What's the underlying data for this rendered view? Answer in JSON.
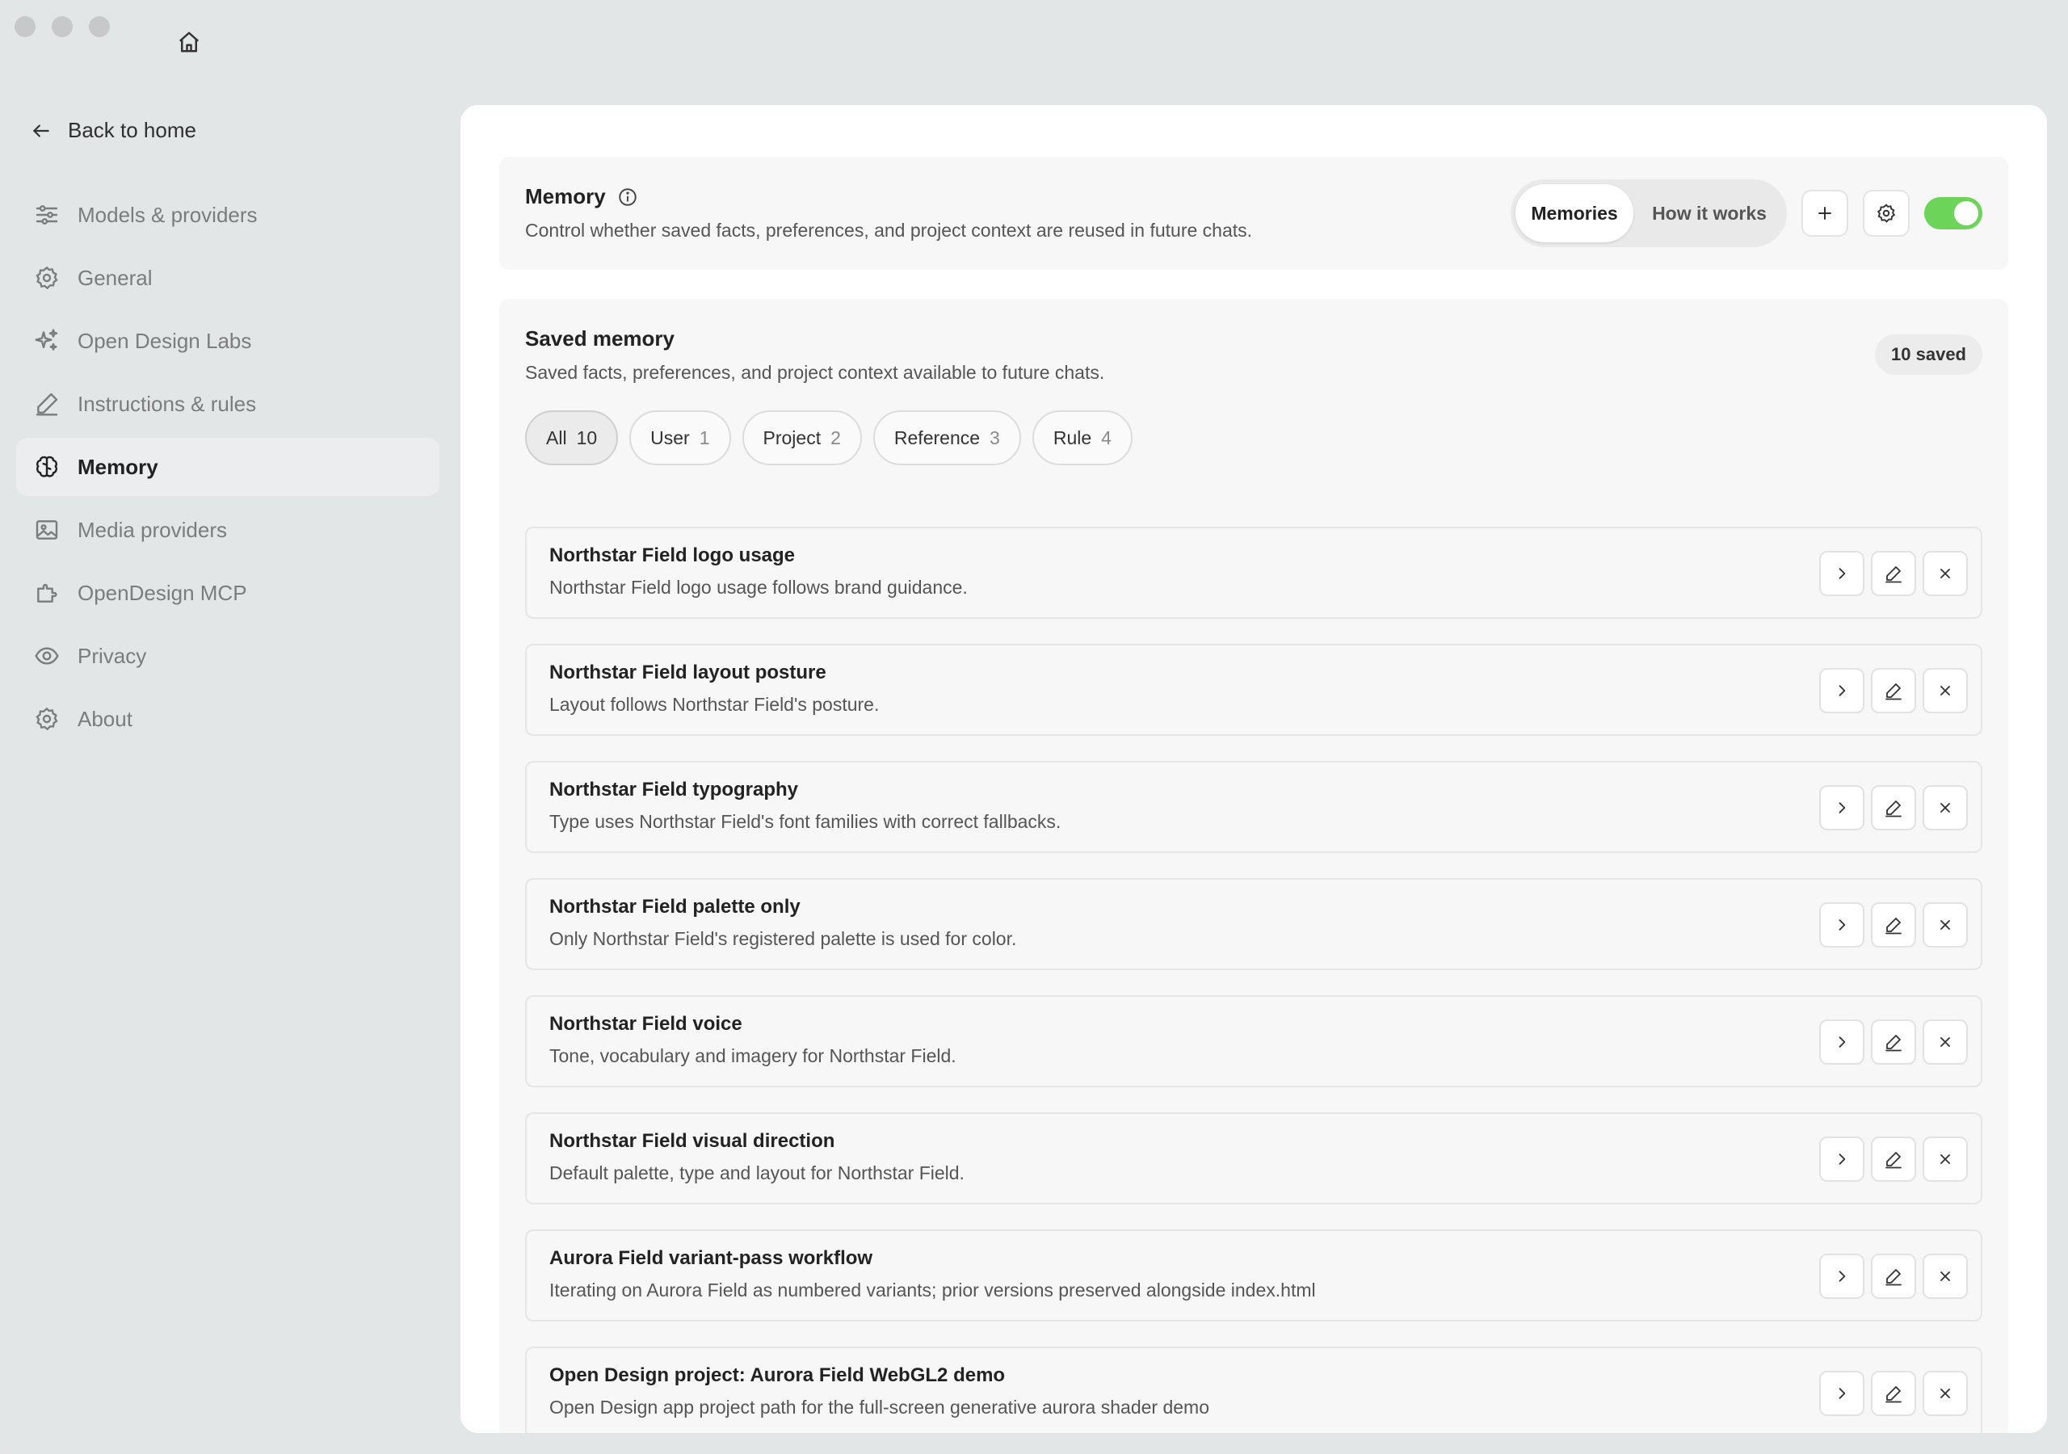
{
  "sidebar": {
    "back_label": "Back to home",
    "items": [
      {
        "label": "Models & providers",
        "icon": "sliders-icon",
        "active": false
      },
      {
        "label": "General",
        "icon": "gear-icon",
        "active": false
      },
      {
        "label": "Open Design Labs",
        "icon": "sparkles-icon",
        "active": false
      },
      {
        "label": "Instructions & rules",
        "icon": "pen-icon",
        "active": false
      },
      {
        "label": "Memory",
        "icon": "brain-icon",
        "active": true
      },
      {
        "label": "Media providers",
        "icon": "image-icon",
        "active": false
      },
      {
        "label": "OpenDesign MCP",
        "icon": "puzzle-icon",
        "active": false
      },
      {
        "label": "Privacy",
        "icon": "eye-icon",
        "active": false
      },
      {
        "label": "About",
        "icon": "gear-icon",
        "active": false
      }
    ]
  },
  "memory": {
    "title": "Memory",
    "description": "Control whether saved facts, preferences, and project context are reused in future chats.",
    "tab_memories": "Memories",
    "tab_how": "How it works",
    "enabled": true,
    "toggle_color": "#6dd45a"
  },
  "saved": {
    "title": "Saved memory",
    "description": "Saved facts, preferences, and project context available to future chats.",
    "badge": "10 saved",
    "filters": [
      {
        "label": "All",
        "count": "10",
        "active": true
      },
      {
        "label": "User",
        "count": "1",
        "active": false
      },
      {
        "label": "Project",
        "count": "2",
        "active": false
      },
      {
        "label": "Reference",
        "count": "3",
        "active": false
      },
      {
        "label": "Rule",
        "count": "4",
        "active": false
      }
    ],
    "items": [
      {
        "title": "Northstar Field logo usage",
        "desc": "Northstar Field logo usage follows brand guidance."
      },
      {
        "title": "Northstar Field layout posture",
        "desc": "Layout follows Northstar Field's posture."
      },
      {
        "title": "Northstar Field typography",
        "desc": "Type uses Northstar Field's font families with correct fallbacks."
      },
      {
        "title": "Northstar Field palette only",
        "desc": "Only Northstar Field's registered palette is used for color."
      },
      {
        "title": "Northstar Field voice",
        "desc": "Tone, vocabulary and imagery for Northstar Field."
      },
      {
        "title": "Northstar Field visual direction",
        "desc": "Default palette, type and layout for Northstar Field."
      },
      {
        "title": "Aurora Field variant-pass workflow",
        "desc": "Iterating on Aurora Field as numbered variants; prior versions preserved alongside index.html"
      },
      {
        "title": "Open Design project: Aurora Field WebGL2 demo",
        "desc": "Open Design app project path for the full-screen generative aurora shader demo"
      }
    ]
  }
}
